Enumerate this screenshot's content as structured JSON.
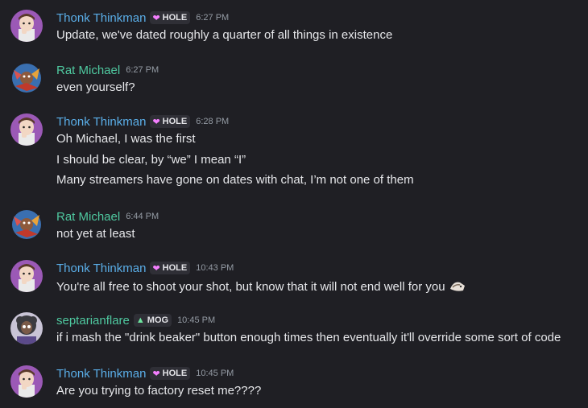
{
  "colors": {
    "background": "#1f1f24",
    "thonk_name": "#5aaee8",
    "rat_name": "#4fc9a0",
    "septarian_name": "#4fc9a0",
    "timestamp": "#949ba4"
  },
  "messages": [
    {
      "author": "Thonk Thinkman",
      "tag": "HOLE",
      "tag_icon": "heart-icon",
      "time": "6:27 PM",
      "lines": [
        "Update, we've dated roughly a quarter of all things in existence"
      ]
    },
    {
      "author": "Rat Michael",
      "time": "6:27 PM",
      "lines": [
        "even yourself?"
      ]
    },
    {
      "author": "Thonk Thinkman",
      "tag": "HOLE",
      "tag_icon": "heart-icon",
      "time": "6:28 PM",
      "lines": [
        "Oh Michael, I was the first",
        "I should be clear, by “we” I mean “I”",
        "Many streamers have gone on dates with chat, I’m not one of them"
      ]
    },
    {
      "author": "Rat Michael",
      "time": "6:44 PM",
      "lines": [
        "not yet at least"
      ]
    },
    {
      "author": "Thonk Thinkman",
      "tag": "HOLE",
      "tag_icon": "heart-icon",
      "time": "10:43 PM",
      "lines": [
        "You're all free to shoot your shot, but know that it will not end well for you"
      ],
      "trailing_emoji": "custom-emoji-icon"
    },
    {
      "author": "septarianflare",
      "tag": "MOG",
      "tag_icon": "drop-icon",
      "time": "10:45 PM",
      "lines": [
        "if i mash the \"drink beaker\" button enough times then eventually it'll override some sort of code"
      ]
    },
    {
      "author": "Thonk Thinkman",
      "tag": "HOLE",
      "tag_icon": "heart-icon",
      "time": "10:45 PM",
      "lines": [
        "Are you trying to factory reset me????"
      ]
    }
  ]
}
